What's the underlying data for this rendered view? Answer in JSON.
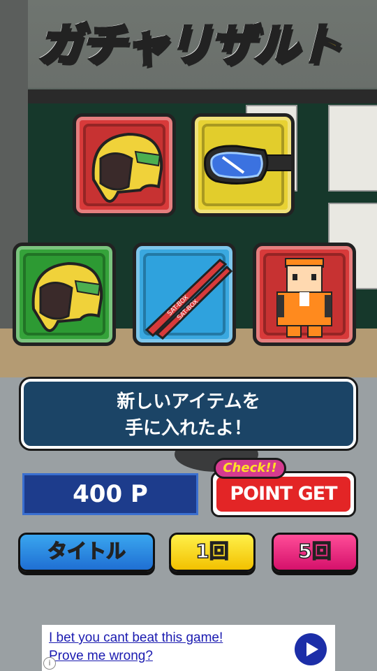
{
  "logo": {
    "text": "ガチャリザルト"
  },
  "items": [
    {
      "name": "helmet-yellow-icon",
      "color": "#d83a3a"
    },
    {
      "name": "goggles-blue-icon",
      "color": "#e8d234"
    },
    {
      "name": "helmet-yellow-icon",
      "color": "#35a33a"
    },
    {
      "name": "skis-red-icon",
      "color": "#3aa8e0"
    },
    {
      "name": "character-orange-suit-icon",
      "color": "#d83a3a"
    }
  ],
  "skis": {
    "text_a": "SAT-BOX",
    "text_b": "SAT-BOX"
  },
  "message": {
    "line1": "新しいアイテムを",
    "line2": "手に入れたよ！"
  },
  "points": {
    "value": "400 P"
  },
  "point_get": {
    "badge": "Check!!",
    "label": "POINT GET"
  },
  "buttons": {
    "title": "タイトル",
    "one": "1回",
    "five": "5回"
  },
  "ad": {
    "line1": "I bet you cant beat this game!",
    "line2": "Prove me wrong?",
    "info": "i"
  }
}
